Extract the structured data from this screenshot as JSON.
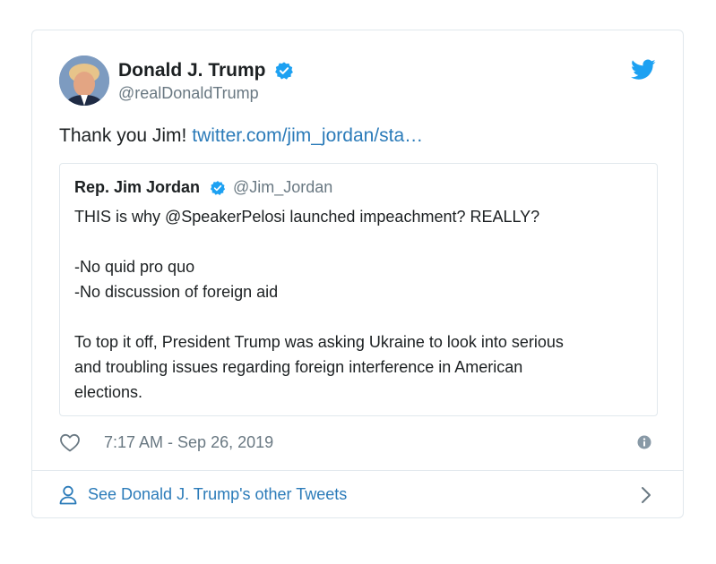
{
  "tweet": {
    "author": {
      "display_name": "Donald J. Trump",
      "handle": "@realDonaldTrump",
      "verified_icon": "verified-badge-icon"
    },
    "text": "Thank you Jim!",
    "link_text": "twitter.com/jim_jordan/sta…",
    "quoted": {
      "display_name": "Rep. Jim Jordan",
      "handle": "@Jim_Jordan",
      "line1": "THIS is why @SpeakerPelosi launched impeachment? REALLY?",
      "line2": "-No quid pro quo",
      "line3": "-No discussion of foreign aid",
      "line4": "To top it off, President Trump was asking Ukraine to look into serious",
      "line5": "and troubling issues regarding foreign interference in American",
      "line6": "elections."
    },
    "timestamp": "7:17 AM - Sep 26, 2019",
    "footer_link": "See Donald J. Trump's other Tweets"
  },
  "icons": {
    "brand": "twitter-bird-icon",
    "like": "heart-icon",
    "info": "info-icon",
    "profile": "person-icon",
    "more": "chevron-right-icon"
  },
  "colors": {
    "link": "#2b7bb9",
    "verified": "#1da1f2",
    "muted": "#697882",
    "border": "#e1e8ed"
  }
}
